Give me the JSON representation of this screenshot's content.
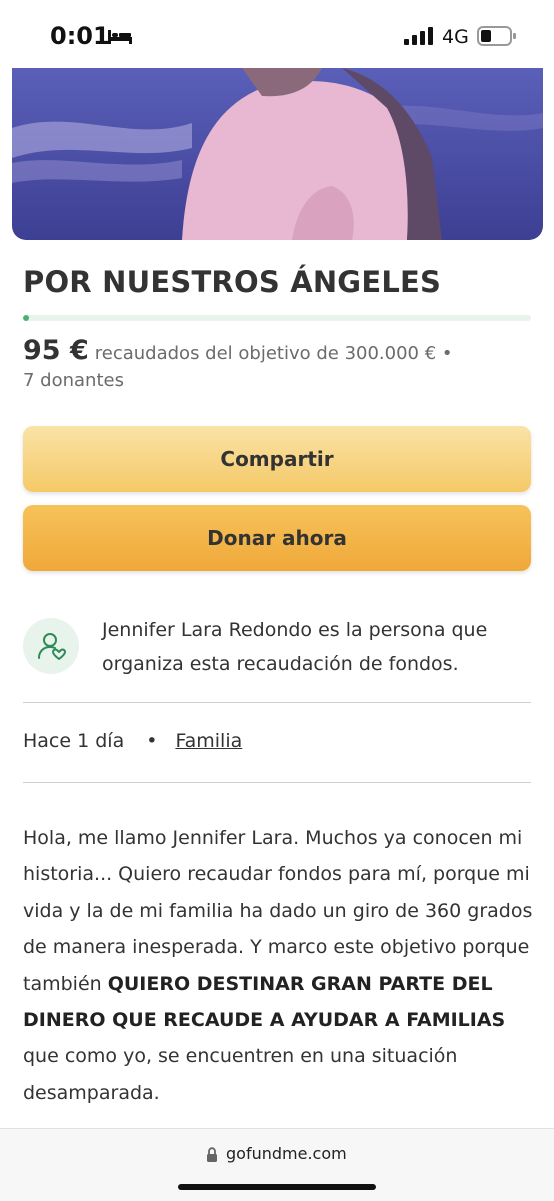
{
  "status_bar": {
    "time": "0:01",
    "network": "4G",
    "icons": [
      "bed-icon",
      "signal-icon",
      "battery-icon"
    ]
  },
  "hero": {
    "description": "campaign-photo"
  },
  "campaign": {
    "title": "POR NUESTROS ÁNGELES",
    "progress_fraction": 0.0003,
    "raised_amount": "95 €",
    "raised_text": "recaudados del objetivo de 300.000 € •",
    "donors": "7 donantes"
  },
  "actions": {
    "share_label": "Compartir",
    "donate_label": "Donar ahora"
  },
  "organizer": {
    "text": "Jennifer Lara Redondo es la persona que organiza esta recaudación de fondos.",
    "icon": "organizer-heart-icon"
  },
  "meta": {
    "time_ago": "Hace 1 día",
    "separator": "•",
    "category": "Familia"
  },
  "story": {
    "part1": "Hola, me llamo Jennifer Lara. Muchos ya conocen mi historia... Quiero recaudar fondos para mí, porque mi vida y la de mi familia ha dado un giro de 360 grados de manera inesperada. Y marco este objetivo porque también ",
    "bold": "QUIERO DESTINAR GRAN PARTE DEL DINERO QUE RECAUDE A AYUDAR A FAMILIAS",
    "part2": " que como yo, se encuentren en una situación desamparada."
  },
  "browser": {
    "url": "gofundme.com"
  },
  "colors": {
    "progress": "#4caf72",
    "share_button": "#f7d88a",
    "donate_button": "#f2b247",
    "organizer_icon_bg": "#e8f3ec"
  }
}
